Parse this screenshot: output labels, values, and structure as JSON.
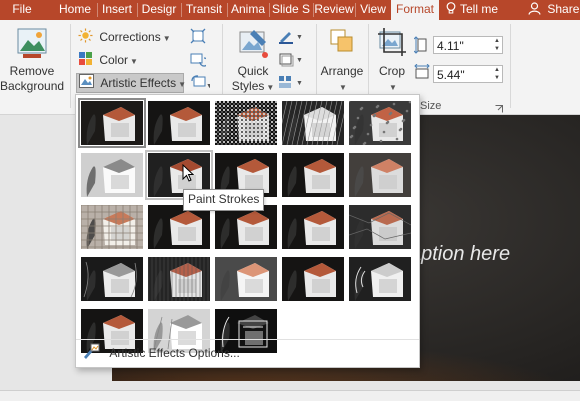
{
  "tabs": [
    {
      "label": "File",
      "active": false
    },
    {
      "label": "Home",
      "active": false
    },
    {
      "label": "Insert",
      "active": false
    },
    {
      "label": "Desigr",
      "active": false
    },
    {
      "label": "Transit",
      "active": false
    },
    {
      "label": "Anima",
      "active": false
    },
    {
      "label": "Slide S",
      "active": false
    },
    {
      "label": "Review",
      "active": false
    },
    {
      "label": "View",
      "active": false
    },
    {
      "label": "Format",
      "active": true
    }
  ],
  "tell_me": "Tell me",
  "share": "Share",
  "ribbon": {
    "remove_background": {
      "line1": "Remove",
      "line2": "Background"
    },
    "corrections": "Corrections",
    "color": "Color",
    "artistic_effects": "Artistic Effects",
    "quick_styles": {
      "line1": "Quick",
      "line2": "Styles"
    },
    "arrange": "Arrange",
    "crop": "Crop",
    "height_value": "4.11\"",
    "width_value": "5.44\"",
    "size_group_label": "Size"
  },
  "gallery": {
    "selected_index": 0,
    "hovered_index": 6,
    "tooltip": "Paint Strokes",
    "options_label": "Artistic Effects Options...",
    "effects": [
      {
        "style": "plain"
      },
      {
        "style": "dark"
      },
      {
        "style": "noisy"
      },
      {
        "style": "sketch"
      },
      {
        "style": "marker"
      },
      {
        "style": "pencil-gray"
      },
      {
        "style": "paint-strokes"
      },
      {
        "style": "dark"
      },
      {
        "style": "dark"
      },
      {
        "style": "blur"
      },
      {
        "style": "mosaic"
      },
      {
        "style": "dark"
      },
      {
        "style": "dark"
      },
      {
        "style": "dark"
      },
      {
        "style": "crumpled"
      },
      {
        "style": "line-drawing"
      },
      {
        "style": "grid"
      },
      {
        "style": "glow"
      },
      {
        "style": "dark"
      },
      {
        "style": "sketch-bw"
      },
      {
        "style": "dark"
      },
      {
        "style": "light-screen"
      },
      {
        "style": "glow-edges"
      }
    ]
  },
  "slide": {
    "caption": "aption here"
  },
  "colors": {
    "accent": "#b7472a",
    "ribbon_bg": "#f3f3f3",
    "slide_bg": "#2c2a28"
  }
}
